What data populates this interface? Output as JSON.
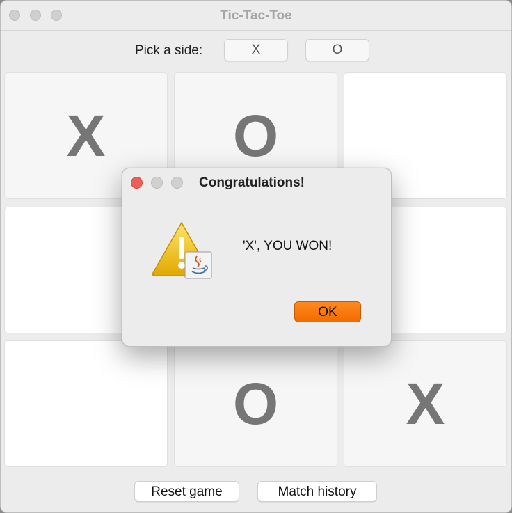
{
  "window": {
    "title": "Tic-Tac-Toe"
  },
  "side_picker": {
    "label": "Pick a side:",
    "options": [
      "X",
      "O"
    ]
  },
  "board": {
    "cells": [
      "X",
      "O",
      "",
      "",
      "",
      "",
      "",
      "O",
      "X"
    ]
  },
  "footer": {
    "reset_label": "Reset game",
    "history_label": "Match history"
  },
  "dialog": {
    "title": "Congratulations!",
    "message": "'X',  YOU WON!",
    "ok_label": "OK",
    "icon": "warning-java-icon"
  },
  "colors": {
    "ok_button": "#f57500",
    "close_button": "#ec5f57",
    "mark": "#767676"
  }
}
